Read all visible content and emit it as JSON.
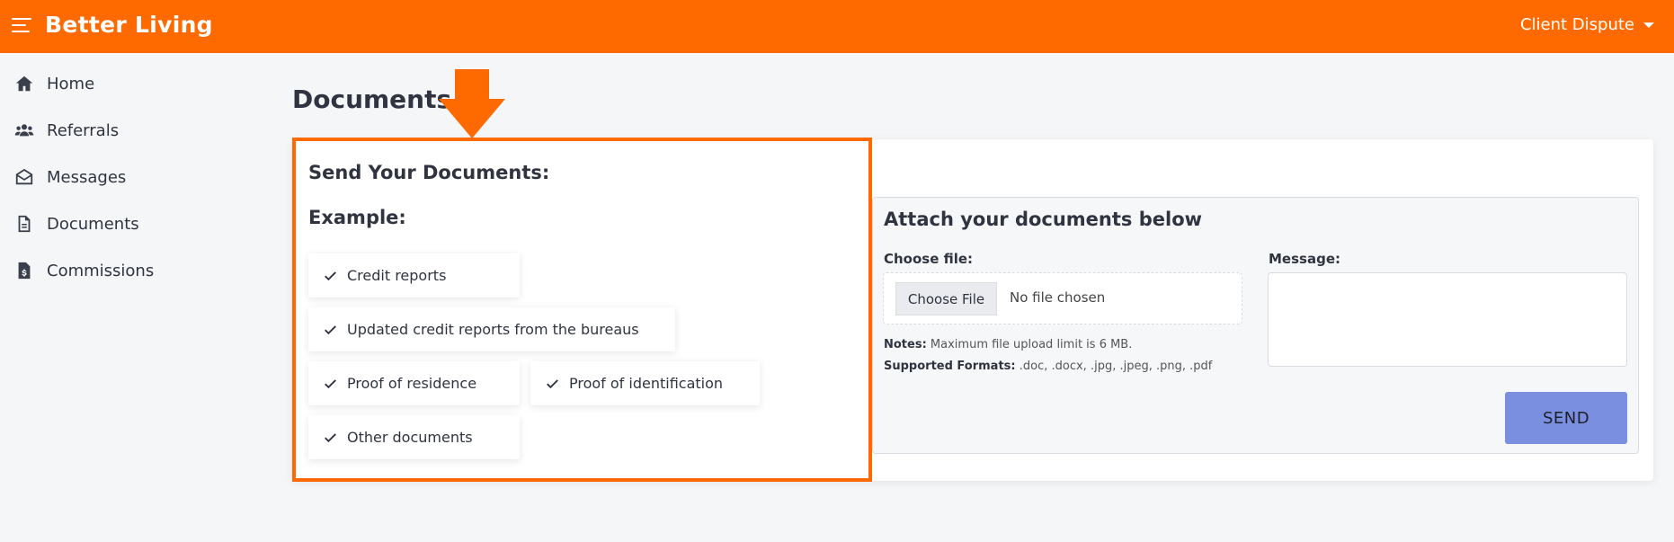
{
  "header": {
    "brand": "Better Living",
    "user_menu": "Client Dispute",
    "menu_icon": "hamburger-icon",
    "brand_color": "#ff6a00"
  },
  "sidebar": {
    "items": [
      {
        "label": "Home",
        "icon": "home-icon"
      },
      {
        "label": "Referrals",
        "icon": "users-icon"
      },
      {
        "label": "Messages",
        "icon": "envelope-open-icon"
      },
      {
        "label": "Documents",
        "icon": "document-icon"
      },
      {
        "label": "Commissions",
        "icon": "invoice-dollar-icon"
      }
    ]
  },
  "main": {
    "title": "Documents",
    "send_title": "Send Your Documents:",
    "example_title": "Example:",
    "examples": [
      "Credit reports",
      "Updated credit reports from the bureaus",
      "Proof of residence",
      "Proof of identification",
      "Other documents"
    ],
    "attach": {
      "title": "Attach your documents below",
      "choose_label": "Choose file:",
      "choose_button": "Choose File",
      "no_file": "No file chosen",
      "notes_label": "Notes:",
      "notes_text": "Maximum file upload limit is 6 MB.",
      "formats_label": "Supported Formats:",
      "formats_text": ".doc, .docx, .jpg, .jpeg, .png, .pdf",
      "message_label": "Message:",
      "message_value": "",
      "send_button": "SEND",
      "send_color": "#7b8fe0"
    }
  }
}
